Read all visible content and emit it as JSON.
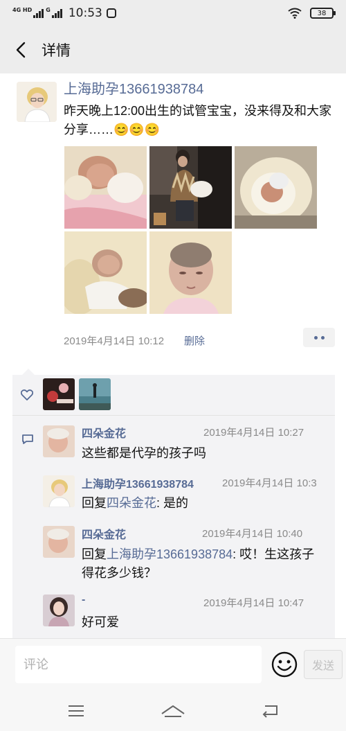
{
  "status_bar": {
    "network": "4G HD",
    "network2": "G",
    "time": "10:53",
    "battery": "38"
  },
  "nav": {
    "title": "详情"
  },
  "post": {
    "author": "上海助孕13661938784",
    "text": "昨天晚上12:00出生的试管宝宝，没来得及和大家分享……😊😊😊",
    "time": "2019年4月14日 10:12",
    "delete_label": "删除"
  },
  "comments": [
    {
      "name": "四朵金花",
      "time": "2019年4月14日 10:27",
      "text": "这些都是代孕的孩子吗"
    },
    {
      "name": "上海助孕13661938784",
      "time": "2019年4月14日 10:3",
      "reply_prefix": "回复",
      "reply_to": "四朵金花",
      "text": ": 是的"
    },
    {
      "name": "四朵金花",
      "time": "2019年4月14日 10:40",
      "reply_prefix": "回复",
      "reply_to": "上海助孕13661938784",
      "text": ": 哎！生这孩子得花多少钱？"
    },
    {
      "name": "-",
      "time": "2019年4月14日 10:47",
      "text": "好可爱"
    }
  ],
  "input": {
    "placeholder": "评论",
    "send_label": "发送"
  },
  "colors": {
    "link": "#576b95",
    "panel": "#f3f3f5",
    "nav_bg": "#ededed"
  }
}
